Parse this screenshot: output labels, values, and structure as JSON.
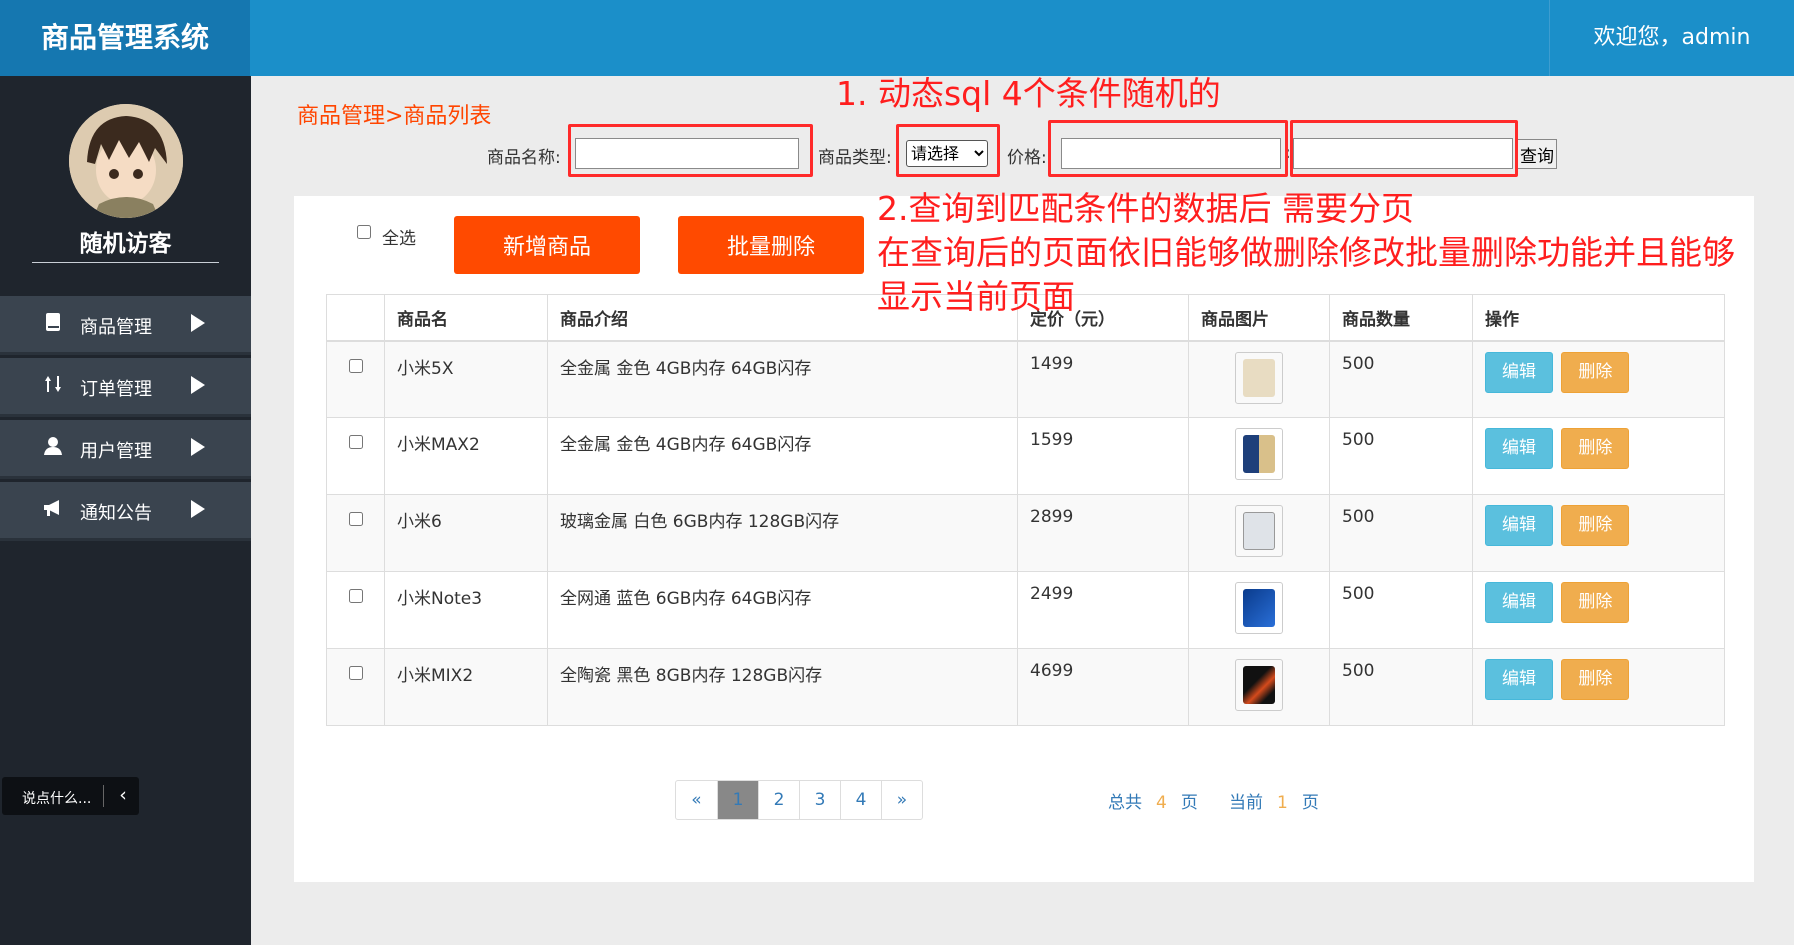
{
  "header": {
    "app_title": "商品管理系统",
    "welcome": "欢迎您，admin"
  },
  "sidebar": {
    "user_name": "随机访客",
    "items": [
      {
        "label": "商品管理",
        "icon": "book-icon"
      },
      {
        "label": "订单管理",
        "icon": "sort-arrows-icon"
      },
      {
        "label": "用户管理",
        "icon": "user-icon"
      },
      {
        "label": "通知公告",
        "icon": "megaphone-icon"
      }
    ],
    "chat": {
      "label": "说点什么...",
      "toggle": "‹"
    }
  },
  "breadcrumb": "商品管理>商品列表",
  "search": {
    "name_label": "商品名称:",
    "name_value": "",
    "type_label": "商品类型:",
    "type_selected": "请选择",
    "price_label": "价格:",
    "price_min": "",
    "price_sep": ":",
    "price_max": "",
    "query_button": "查询"
  },
  "annotations": {
    "note1": "1. 动态sql    4个条件随机的",
    "note2_line1": "2.查询到匹配条件的数据后   需要分页",
    "note2_line2": "在查询后的页面依旧能够做删除修改批量删除功能并且能够",
    "note2_line3": "显示当前页面"
  },
  "toolbar": {
    "select_all": "全选",
    "add_button": "新增商品",
    "batch_delete_button": "批量删除"
  },
  "table": {
    "columns": [
      "",
      "商品名",
      "商品介绍",
      "定价（元）",
      "商品图片",
      "商品数量",
      "操作"
    ],
    "edit_label": "编辑",
    "delete_label": "删除",
    "rows": [
      {
        "name": "小米5X",
        "desc": "全金属 金色 4GB内存 64GB闪存",
        "price": "1499",
        "qty": "500",
        "image": "gold-phone"
      },
      {
        "name": "小米MAX2",
        "desc": "全金属 金色 4GB内存 64GB闪存",
        "price": "1599",
        "qty": "500",
        "image": "gold-phone-front"
      },
      {
        "name": "小米6",
        "desc": "玻璃金属 白色 6GB内存 128GB闪存",
        "price": "2899",
        "qty": "500",
        "image": "white-phone"
      },
      {
        "name": "小米Note3",
        "desc": "全网通 蓝色 6GB内存 64GB闪存",
        "price": "2499",
        "qty": "500",
        "image": "blue-phone"
      },
      {
        "name": "小米MIX2",
        "desc": "全陶瓷 黑色 8GB内存 128GB闪存",
        "price": "4699",
        "qty": "500",
        "image": "black-phone"
      }
    ]
  },
  "pagination": {
    "prev": "«",
    "pages": [
      "1",
      "2",
      "3",
      "4"
    ],
    "active": "1",
    "next": "»",
    "total_prefix": "总共",
    "total_pages": "4",
    "total_suffix": "页",
    "current_prefix": "当前",
    "current_page": "1",
    "current_suffix": "页"
  },
  "colors": {
    "header": "#1b8fc9",
    "title_block": "#1577b0",
    "sidebar": "#1f252d",
    "nav_item": "#3a444f",
    "accent": "#ff4a00",
    "edit": "#5bc0de",
    "delete": "#f0ad4e",
    "annotation": "#ff1e1e"
  }
}
